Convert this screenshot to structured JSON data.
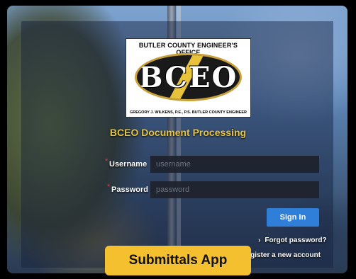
{
  "logo": {
    "top_text": "BUTLER COUNTY ENGINEER'S OFFICE",
    "acronym": "BCEO",
    "bottom_text": "GREGORY J. WILKENS, P.E., P.S. BUTLER COUNTY ENGINEER"
  },
  "app_title": "BCEO Document Processing",
  "form": {
    "username_label": "Username",
    "username_placeholder": "username",
    "username_value": "",
    "password_label": "Password",
    "password_placeholder": "password",
    "password_value": "",
    "required_marker": "*",
    "signin_label": "Sign In"
  },
  "links": {
    "forgot": "Forgot password?",
    "register": "Register a new account"
  },
  "badge": "Submittals App",
  "colors": {
    "title": "#e6c63e",
    "button": "#2f7ed8",
    "badge": "#f5c030",
    "required": "#d93b3b"
  }
}
